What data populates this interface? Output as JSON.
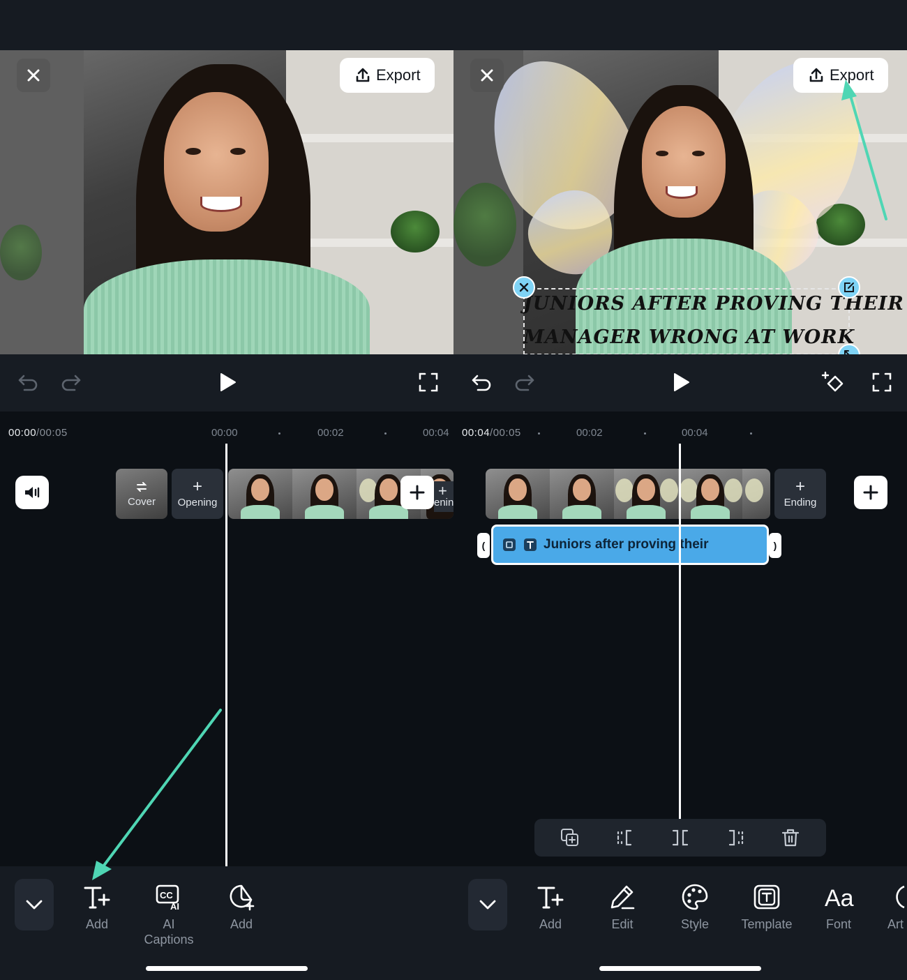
{
  "left": {
    "export_label": "Export",
    "time_current": "00:00",
    "time_total": "/00:05",
    "ticks": [
      "00:00",
      "00:02",
      "00:04"
    ],
    "cover_label": "Cover",
    "opening_label": "Opening",
    "opening_partial_label": "ening",
    "tools": [
      {
        "label": "Add",
        "icon": "text-add-icon"
      },
      {
        "label": "AI\nCaptions",
        "icon": "ai-captions-icon"
      },
      {
        "label": "Add",
        "icon": "sticker-add-icon"
      }
    ]
  },
  "right": {
    "export_label": "Export",
    "time_current": "00:04",
    "time_total": "/00:05",
    "ticks": [
      "00:02",
      "00:04"
    ],
    "ending_label": "Ending",
    "caption_line1": "Juniors after proving their",
    "caption_line2": "Manager wrong at work",
    "text_clip_label": "Juniors after proving their",
    "tools": [
      {
        "label": "Add",
        "icon": "text-add-icon"
      },
      {
        "label": "Edit",
        "icon": "pencil-icon"
      },
      {
        "label": "Style",
        "icon": "palette-icon"
      },
      {
        "label": "Template",
        "icon": "template-icon"
      },
      {
        "label": "Font",
        "icon": "font-icon"
      },
      {
        "label": "Art",
        "icon": "art-icon"
      }
    ],
    "clip_actions": [
      "duplicate-icon",
      "trim-start-icon",
      "split-icon",
      "trim-end-icon",
      "delete-icon"
    ]
  },
  "colors": {
    "accent_arrow": "#4fd6b4",
    "text_clip": "#4aa9e8",
    "background": "#0c1015"
  }
}
